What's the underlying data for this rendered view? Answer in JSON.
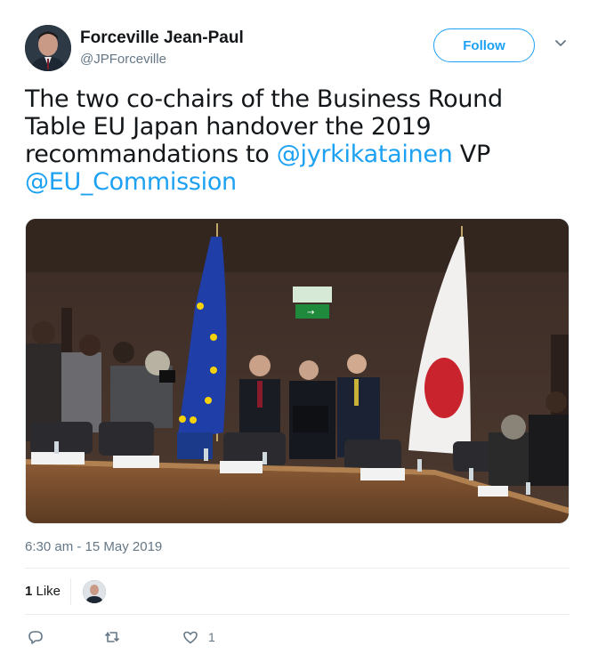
{
  "author": {
    "name": "Forceville Jean-Paul",
    "handle": "@JPForceville",
    "follow_label": "Follow"
  },
  "tweet": {
    "text_part1": "The two co-chairs of the Business Round Table EU Japan handover the 2019 recommandations to ",
    "mention1": "@jyrkikatainen",
    "text_part2": " VP ",
    "mention2": "@EU_Commission",
    "timestamp": "6:30 am - 15 May 2019"
  },
  "stats": {
    "likes_count": "1",
    "likes_label": " Like"
  },
  "actions": {
    "reply_count": "",
    "retweet_count": "",
    "like_count": "1"
  },
  "colors": {
    "accent": "#1da1f2",
    "muted": "#657786",
    "text": "#14171a",
    "divider": "#e6ecf0"
  },
  "icons": [
    "chevron-down-icon",
    "reply-icon",
    "retweet-icon",
    "heart-icon"
  ]
}
